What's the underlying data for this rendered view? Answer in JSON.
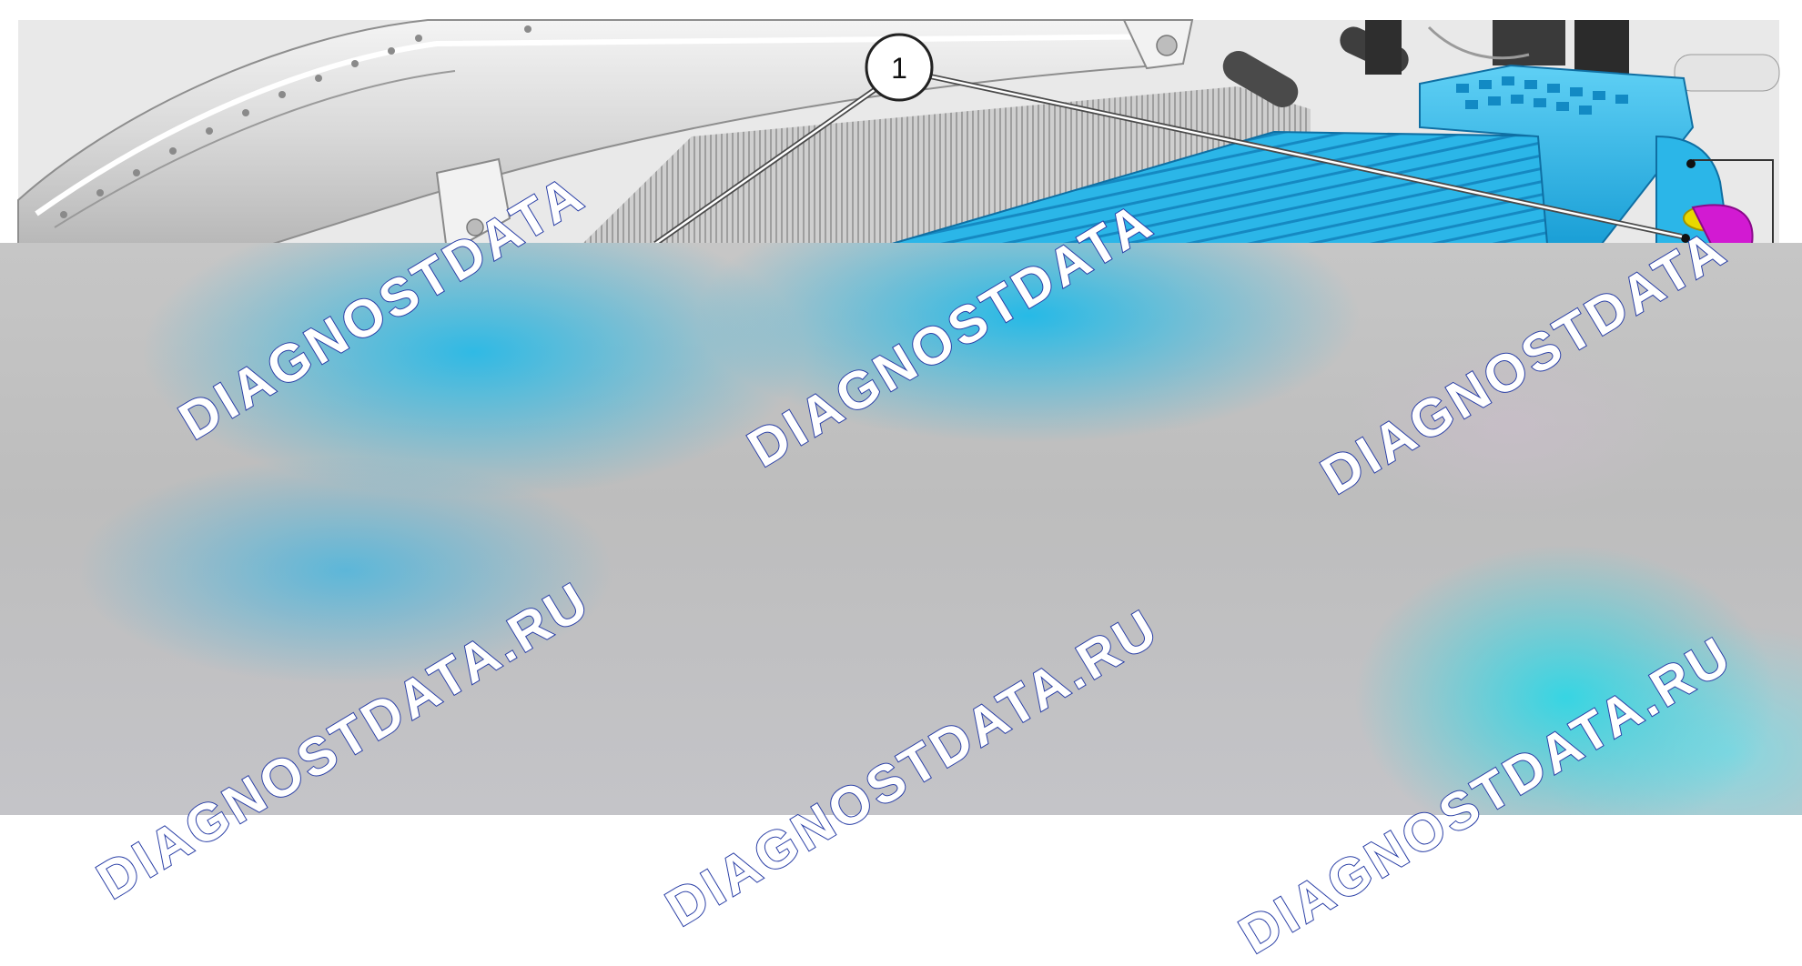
{
  "diagram": {
    "callouts": [
      {
        "label": "1"
      }
    ],
    "components": [
      "radiator-support",
      "intercooler",
      "intercooler-outlet-pipe"
    ],
    "colors": {
      "intercooler": "#2bb6e8",
      "pipe_clamp_magenta": "#d21ad2",
      "pipe_ring_yellow": "#e8d800",
      "watermark_outline": "#2a3fa6"
    }
  },
  "watermarks": [
    "DIAGNOSTDATA",
    "DIAGNOSTDATA",
    "DIAGNOSTDATA",
    "DIAGNOSTDATA.RU",
    "DIAGNOSTDATA.RU",
    "DIAGNOSTDATA.RU"
  ]
}
